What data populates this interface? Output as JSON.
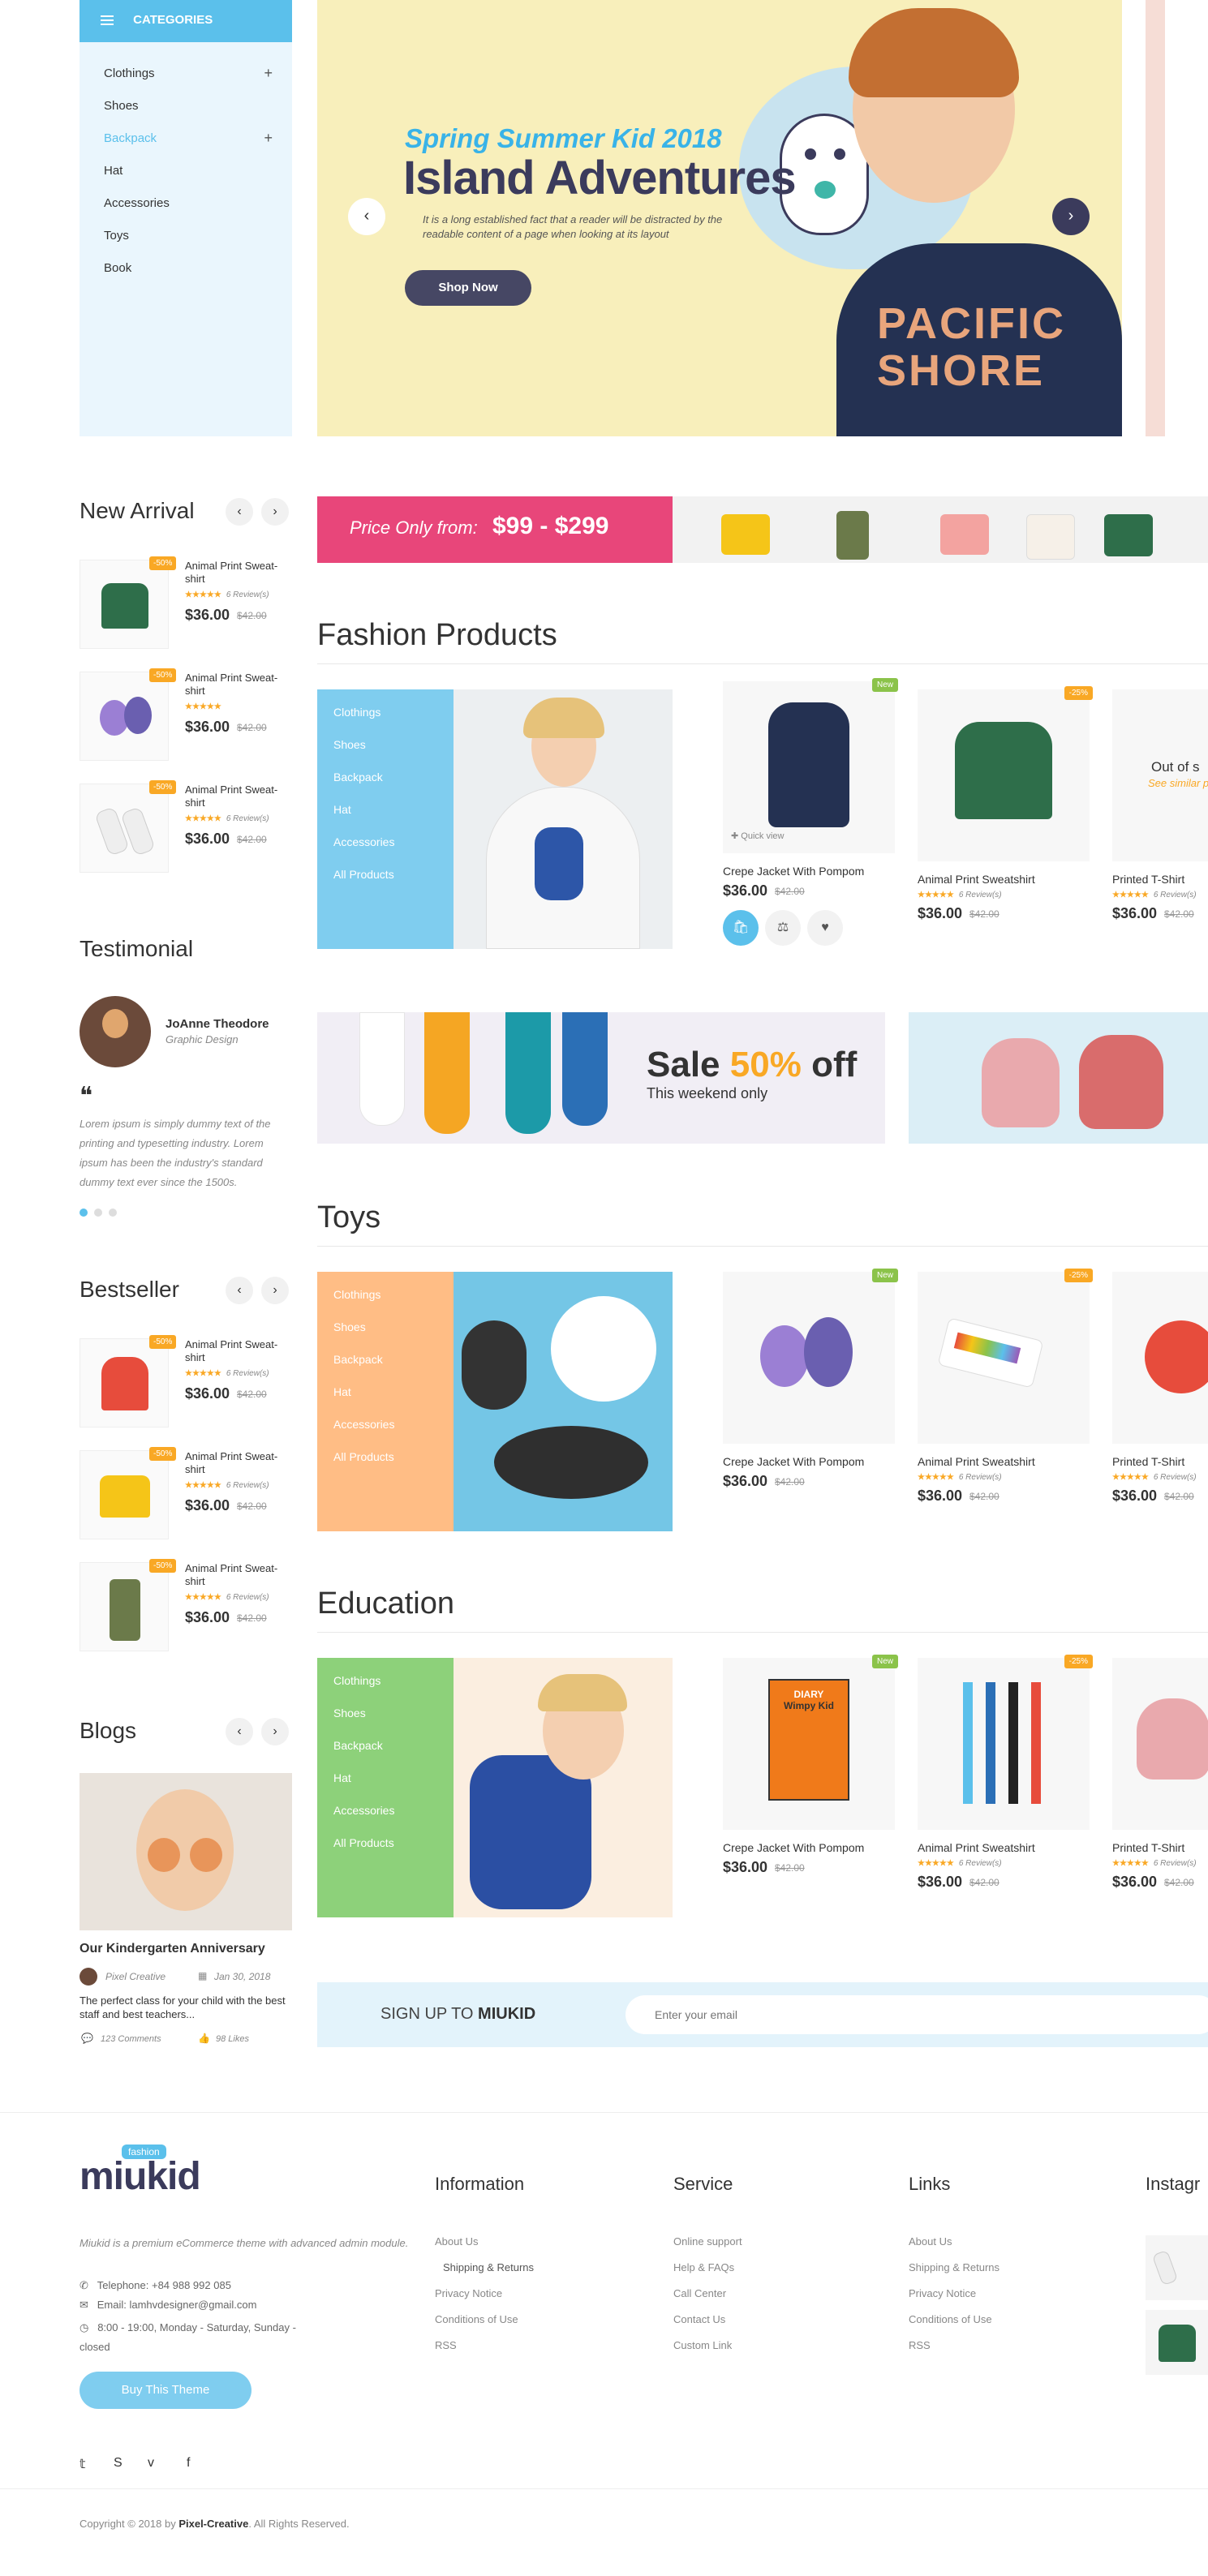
{
  "categories": {
    "title": "CATEGORIES",
    "items": [
      {
        "label": "Clothings",
        "plus": "+"
      },
      {
        "label": "Shoes",
        "plus": ""
      },
      {
        "label": "Backpack",
        "plus": "+"
      },
      {
        "label": "Hat",
        "plus": ""
      },
      {
        "label": "Accessories",
        "plus": ""
      },
      {
        "label": "Toys",
        "plus": ""
      },
      {
        "label": "Book",
        "plus": ""
      }
    ]
  },
  "hero": {
    "subtitle": "Spring Summer Kid 2018",
    "title": "Island Adventures",
    "text": "It is a long established fact that a reader will be distracted by the readable content of a page when looking at its layout",
    "button": "Shop Now",
    "shirt_print_1": "PACIFIC",
    "shirt_print_2": "SHORE"
  },
  "new_arrival": {
    "title": "New Arrival",
    "items": [
      {
        "badge": "-50%",
        "name": "Animal Print Sweat-shirt",
        "stars": "★★★★★",
        "reviews": "6 Review(s)",
        "price": "$36.00",
        "old": "$42.00"
      },
      {
        "badge": "-50%",
        "name": "Animal Print Sweat-shirt",
        "stars": "★★★★★",
        "reviews": "6 Review(s)",
        "price": "$36.00",
        "old": "$42.00"
      },
      {
        "badge": "-50%",
        "name": "Animal Print Sweat-shirt",
        "stars": "★★★★★",
        "reviews": "6 Review(s)",
        "price": "$36.00",
        "old": "$42.00"
      }
    ]
  },
  "testimonial": {
    "title": "Testimonial",
    "name": "JoAnne Theodore",
    "role": "Graphic Design",
    "quote_mark": "❝",
    "text": "Lorem ipsum is simply dummy text of the printing and typesetting industry. Lorem ipsum has been the industry's standard dummy text ever since the 1500s."
  },
  "bestseller": {
    "title": "Bestseller",
    "items": [
      {
        "badge": "-50%",
        "name": "Animal Print Sweat-shirt",
        "stars": "★★★★★",
        "reviews": "6 Review(s)",
        "price": "$36.00",
        "old": "$42.00"
      },
      {
        "badge": "-50%",
        "name": "Animal Print Sweat-shirt",
        "stars": "★★★★★",
        "reviews": "6 Review(s)",
        "price": "$36.00",
        "old": "$42.00"
      },
      {
        "badge": "-50%",
        "name": "Animal Print Sweat-shirt",
        "stars": "★★★★★",
        "reviews": "6 Review(s)",
        "price": "$36.00",
        "old": "$42.00"
      }
    ]
  },
  "blogs": {
    "title": "Blogs",
    "post_title": "Our Kindergarten Anniversary",
    "author": "Pixel Creative",
    "date": "Jan 30, 2018",
    "excerpt": "The perfect class for your child with the best staff and best teachers...",
    "comments": "123 Comments",
    "likes": "98 Likes"
  },
  "promo": {
    "label": "Price Only from:",
    "range": "$99 - $299"
  },
  "fashion": {
    "title": "Fashion Products",
    "menu": [
      "Clothings",
      "Shoes",
      "Backpack",
      "Hat",
      "Accessories",
      "All Products"
    ],
    "products": [
      {
        "tag": "New",
        "name": "Crepe Jacket With Pompom",
        "stars": "",
        "reviews": "",
        "price": "$36.00",
        "old": "$42.00",
        "quick": "Quick view"
      },
      {
        "tag": "-25%",
        "name": "Animal Print Sweatshirt",
        "stars": "★★★★★",
        "reviews": "6 Review(s)",
        "price": "$36.00",
        "old": "$42.00"
      },
      {
        "tag": "",
        "name": "Printed T-Shirt",
        "stars": "★★★★★",
        "reviews": "6 Review(s)",
        "price": "$36.00",
        "old": "$42.00",
        "sold_out": "Out of s",
        "similar": "See similar p"
      }
    ]
  },
  "sale": {
    "title_1": "Sale",
    "title_2": "50%",
    "title_3": "off",
    "subtitle": "This weekend only"
  },
  "toys": {
    "title": "Toys",
    "menu": [
      "Clothings",
      "Shoes",
      "Backpack",
      "Hat",
      "Accessories",
      "All Products"
    ],
    "products": [
      {
        "tag": "New",
        "name": "Crepe Jacket With Pompom",
        "stars": "",
        "reviews": "",
        "price": "$36.00",
        "old": "$42.00"
      },
      {
        "tag": "-25%",
        "name": "Animal Print Sweatshirt",
        "stars": "★★★★★",
        "reviews": "6 Review(s)",
        "price": "$36.00",
        "old": "$42.00"
      },
      {
        "tag": "",
        "name": "Printed T-Shirt",
        "stars": "★★★★★",
        "reviews": "6 Review(s)",
        "price": "$36.00",
        "old": "$42.00"
      }
    ]
  },
  "education": {
    "title": "Education",
    "menu": [
      "Clothings",
      "Shoes",
      "Backpack",
      "Hat",
      "Accessories",
      "All Products"
    ],
    "products": [
      {
        "tag": "New",
        "name": "Crepe Jacket With Pompom",
        "stars": "",
        "reviews": "",
        "price": "$36.00",
        "old": "$42.00",
        "book_1": "DIARY",
        "book_2": "Wimpy Kid"
      },
      {
        "tag": "-25%",
        "name": "Animal Print Sweatshirt",
        "stars": "★★★★★",
        "reviews": "6 Review(s)",
        "price": "$36.00",
        "old": "$42.00"
      },
      {
        "tag": "",
        "name": "Printed T-Shirt",
        "stars": "★★★★★",
        "reviews": "6 Review(s)",
        "price": "$36.00",
        "old": "$42.00"
      }
    ]
  },
  "newsletter": {
    "label_1": "SIGN UP TO",
    "label_2": "MIUKID",
    "placeholder": "Enter your email"
  },
  "footer": {
    "logo": "miukid",
    "logo_tag": "fashion",
    "description": "Miukid is a premium eCommerce theme with advanced admin module.",
    "phone": "Telephone: +84 988 992 085",
    "email": "Email: lamhvdesigner@gmail.com",
    "hours": "8:00 - 19:00, Monday - Saturday, Sunday - closed",
    "button": "Buy This Theme",
    "columns": [
      {
        "title": "Information",
        "links": [
          "About Us",
          "Shipping & Returns",
          "Privacy Notice",
          "Conditions of Use",
          "RSS"
        ]
      },
      {
        "title": "Service",
        "links": [
          "Online support",
          "Help & FAQs",
          "Call Center",
          "Contact Us",
          "Custom Link"
        ]
      },
      {
        "title": "Links",
        "links": [
          "About Us",
          "Shipping & Returns",
          "Privacy Notice",
          "Conditions of Use",
          "RSS"
        ]
      }
    ],
    "instagram_title": "Instagr",
    "social": [
      "𝕥",
      "S",
      "v",
      "f"
    ],
    "copyright_1": "Copyright © 2018 by",
    "copyright_2": "Pixel-Creative",
    "copyright_3": ". All Rights Reserved."
  },
  "colors": {
    "accent": "#5bc0eb",
    "dark": "#3b3b5c",
    "pink": "#e8467a",
    "orange": "#f9a825",
    "green_tag": "#8bc34a"
  }
}
